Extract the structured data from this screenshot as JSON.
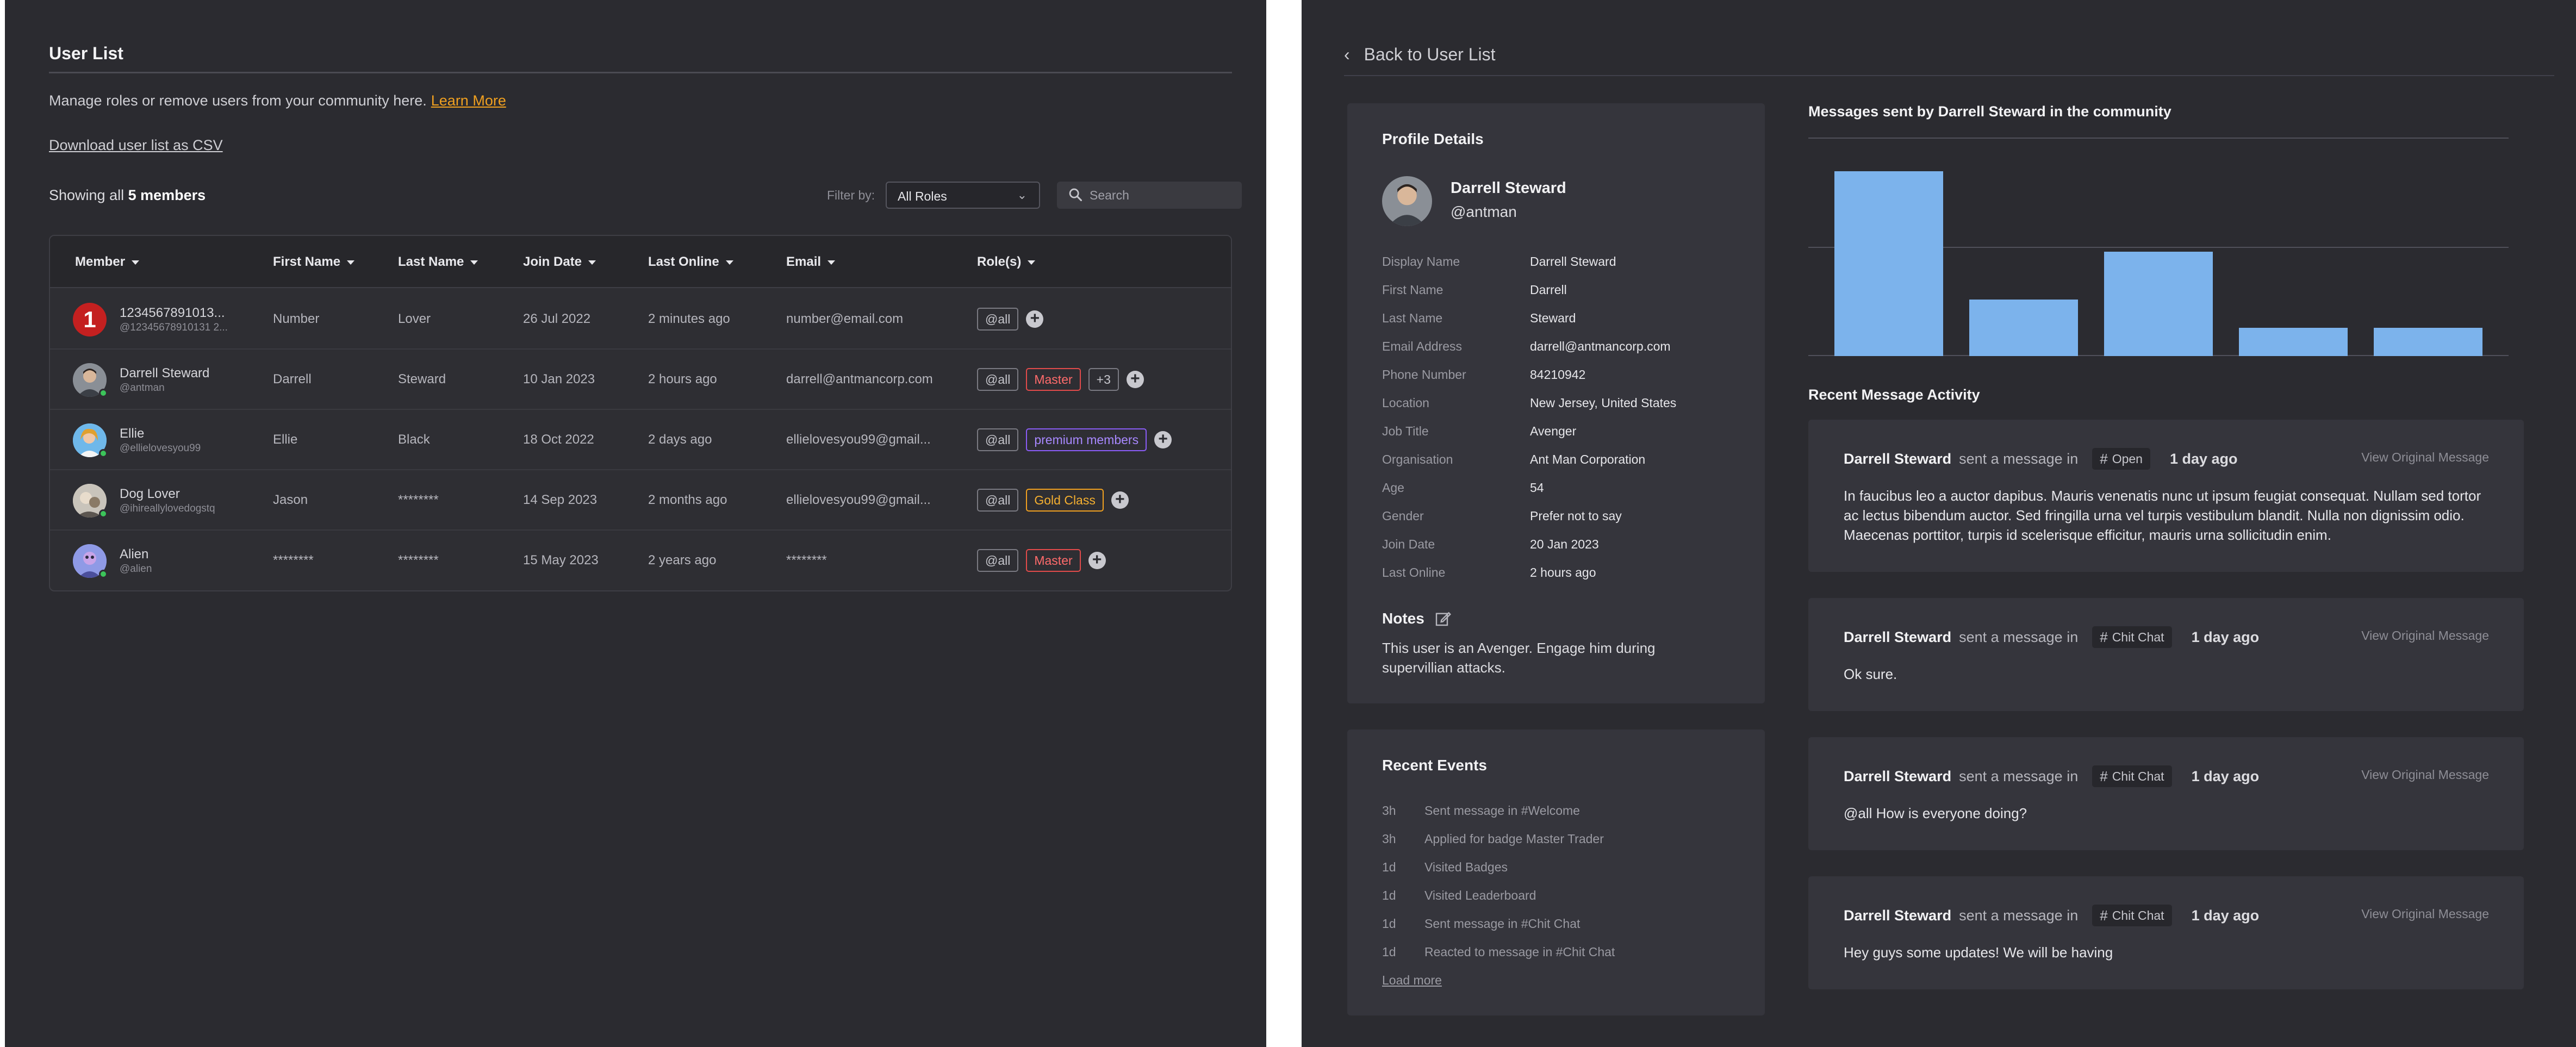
{
  "user_list": {
    "title": "User List",
    "description": "Manage roles or remove users from your community here.",
    "learn_more": "Learn More",
    "download": "Download user list as CSV",
    "showing_prefix": "Showing all",
    "showing_count": "5 members",
    "filter_label": "Filter by:",
    "filter_value": "All Roles",
    "search_placeholder": "Search",
    "columns": [
      "Member",
      "First Name",
      "Last Name",
      "Join Date",
      "Last Online",
      "Email",
      "Role(s)"
    ],
    "rows": [
      {
        "name": "1234567891013...",
        "handle": "@12345678910131 2...",
        "first": "Number",
        "last": "Lover",
        "joined": "26 Jul 2022",
        "online": "2 minutes ago",
        "email": "number@email.com",
        "roles": [
          "@all"
        ],
        "avatar_badge": "1"
      },
      {
        "name": "Darrell Steward",
        "handle": "@antman",
        "first": "Darrell",
        "last": "Steward",
        "joined": "10 Jan 2023",
        "online": "2 hours ago",
        "email": "darrell@antmancorp.com",
        "roles": [
          "@all",
          "Master",
          "+3"
        ]
      },
      {
        "name": "Ellie",
        "handle": "@ellielovesyou99",
        "first": "Ellie",
        "last": "Black",
        "joined": "18 Oct 2022",
        "online": "2 days ago",
        "email": "ellielovesyou99@gmail...",
        "roles": [
          "@all",
          "premium members"
        ]
      },
      {
        "name": "Dog Lover",
        "handle": "@ihireallylovedogstq",
        "first": "Jason",
        "last": "********",
        "joined": "14 Sep 2023",
        "online": "2 months ago",
        "email": "ellielovesyou99@gmail...",
        "roles": [
          "@all",
          "Gold Class"
        ]
      },
      {
        "name": "Alien",
        "handle": "@alien",
        "first": "********",
        "last": "********",
        "joined": "15 May 2023",
        "online": "2 years ago",
        "email": "********",
        "roles": [
          "@all",
          "Master"
        ]
      }
    ]
  },
  "profile": {
    "back_label": "Back to User List",
    "details_title": "Profile Details",
    "name": "Darrell Steward",
    "handle": "@antman",
    "fields": [
      {
        "label": "Display Name",
        "value": "Darrell Steward"
      },
      {
        "label": "First Name",
        "value": "Darrell"
      },
      {
        "label": "Last Name",
        "value": "Steward"
      },
      {
        "label": "Email Address",
        "value": "darrell@antmancorp.com"
      },
      {
        "label": "Phone Number",
        "value": "84210942"
      },
      {
        "label": "Location",
        "value": "New Jersey, United States"
      },
      {
        "label": "Job Title",
        "value": "Avenger"
      },
      {
        "label": "Organisation",
        "value": "Ant Man Corporation"
      },
      {
        "label": "Age",
        "value": "54"
      },
      {
        "label": "Gender",
        "value": "Prefer not to say"
      },
      {
        "label": "Join Date",
        "value": "20 Jan 2023"
      },
      {
        "label": "Last Online",
        "value": "2 hours ago"
      }
    ],
    "notes_title": "Notes",
    "notes_text": "This user is an Avenger. Engage him during supervillian attacks."
  },
  "events": {
    "title": "Recent Events",
    "items": [
      {
        "time": "3h",
        "text": "Sent message in #Welcome"
      },
      {
        "time": "3h",
        "text": "Applied for badge Master Trader"
      },
      {
        "time": "1d",
        "text": "Visited Badges"
      },
      {
        "time": "1d",
        "text": "Visited Leaderboard"
      },
      {
        "time": "1d",
        "text": "Sent message in #Chit Chat"
      },
      {
        "time": "1d",
        "text": "Reacted to message in #Chit Chat"
      }
    ],
    "load_more": "Load more"
  },
  "chart_data": {
    "type": "bar",
    "title": "Messages sent by Darrell Steward in the community",
    "categories": [
      "",
      "",
      "",
      "",
      ""
    ],
    "values": [
      85,
      26,
      48,
      13,
      13
    ],
    "ylim": [
      0,
      100
    ],
    "grid": true,
    "color": "#7cb3ec"
  },
  "activity": {
    "title": "Recent Message Activity",
    "sent_text": "sent a message in",
    "view_label": "View Original Message",
    "messages": [
      {
        "sender": "Darrell Steward",
        "channel": "Open",
        "ago": "1 day ago",
        "body": "In faucibus leo a auctor dapibus. Mauris venenatis nunc ut ipsum feugiat consequat. Nullam sed tortor ac lectus bibendum auctor. Sed fringilla urna vel turpis vestibulum blandit. Nulla non dignissim odio. Maecenas porttitor, turpis id scelerisque efficitur, mauris urna sollicitudin enim."
      },
      {
        "sender": "Darrell Steward",
        "channel": "Chit Chat",
        "ago": "1 day ago",
        "body": "Ok sure."
      },
      {
        "sender": "Darrell Steward",
        "channel": "Chit Chat",
        "ago": "1 day ago",
        "body": "@all How is everyone doing?"
      },
      {
        "sender": "Darrell Steward",
        "channel": "Chit Chat",
        "ago": "1 day ago",
        "body": "Hey guys some updates! We will be having"
      }
    ]
  }
}
